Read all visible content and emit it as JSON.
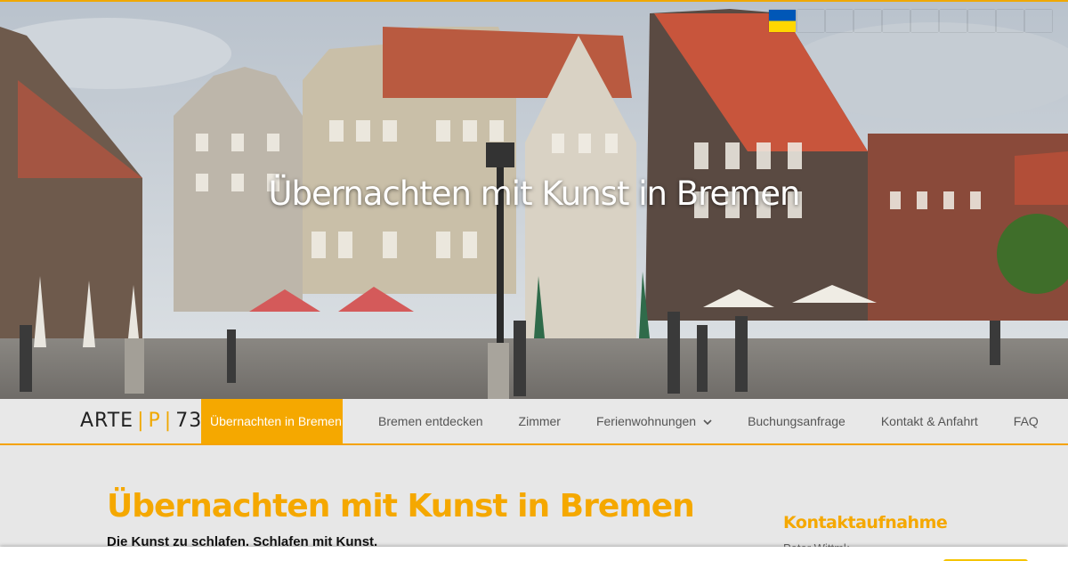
{
  "hero": {
    "title": "Übernachten mit Kunst in Bremen"
  },
  "languages": [
    {
      "code": "da",
      "icon": "flag-denmark"
    },
    {
      "code": "nl",
      "icon": "flag-netherlands"
    },
    {
      "code": "en",
      "icon": "flag-uk"
    },
    {
      "code": "fr",
      "icon": "flag-france"
    },
    {
      "code": "de",
      "icon": "flag-germany"
    },
    {
      "code": "it",
      "icon": "flag-italy"
    },
    {
      "code": "pl",
      "icon": "flag-poland"
    },
    {
      "code": "ru",
      "icon": "flag-russia"
    },
    {
      "code": "es",
      "icon": "flag-spain"
    },
    {
      "code": "uk",
      "icon": "flag-ukraine"
    }
  ],
  "logo": {
    "part1": "ARTE",
    "part2": "P",
    "part3": "73",
    "separator": "|"
  },
  "nav": {
    "items": [
      {
        "label": "Übernachten in Bremen",
        "active": true
      },
      {
        "label": "Bremen entdecken"
      },
      {
        "label": "Zimmer"
      },
      {
        "label": "Ferienwohnungen",
        "dropdown": true
      },
      {
        "label": "Buchungsanfrage"
      },
      {
        "label": "Kontakt & Anfahrt"
      },
      {
        "label": "FAQ"
      }
    ]
  },
  "main": {
    "title": "Übernachten mit Kunst in Bremen",
    "subtitle": "Die Kunst zu schlafen. Schlafen mit Kunst."
  },
  "sidebar": {
    "title": "Kontaktaufnahme",
    "name_partial": "Peter Wittmk..."
  },
  "colors": {
    "accent": "#f5a800",
    "nav_bg": "#e8e8e8",
    "page_bg": "#e7e7e7"
  }
}
